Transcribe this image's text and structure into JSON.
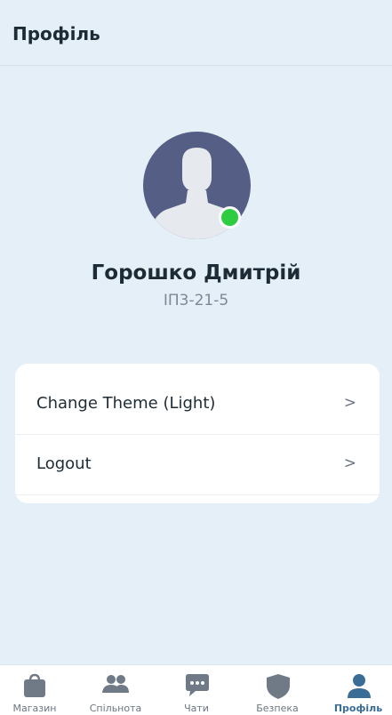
{
  "header": {
    "title": "Профіль"
  },
  "profile": {
    "name": "Горошко Дмитрій",
    "group": "ІП3-21-5",
    "status": "online",
    "status_color": "#2ecc40",
    "avatar_icon": "person-silhouette-icon"
  },
  "menu": {
    "items": [
      {
        "label": "Change Theme (Light)",
        "chevron": ">"
      },
      {
        "label": "Logout",
        "chevron": ">"
      }
    ]
  },
  "bottom_nav": {
    "items": [
      {
        "label": "Магазин",
        "icon": "shopping-bag-icon",
        "active": false
      },
      {
        "label": "Спільнота",
        "icon": "people-icon",
        "active": false
      },
      {
        "label": "Чати",
        "icon": "chat-bubble-icon",
        "active": false
      },
      {
        "label": "Безпека",
        "icon": "shield-icon",
        "active": false
      },
      {
        "label": "Профіль",
        "icon": "person-icon",
        "active": true
      }
    ]
  },
  "colors": {
    "background": "#e4eff7",
    "card": "#ffffff",
    "text": "#1d2b36",
    "active_nav": "#3a6d96",
    "inactive_icon": "#707a87",
    "avatar_bg": "#555e84"
  }
}
